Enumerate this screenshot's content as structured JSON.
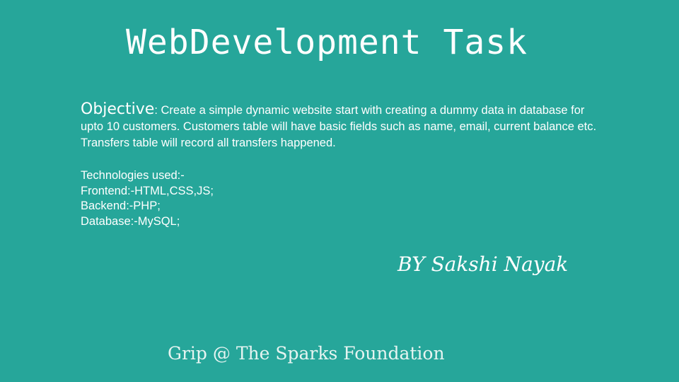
{
  "slide": {
    "title": "WebDevelopment Task",
    "objective": {
      "label": "Objective",
      "separator": ":",
      "text": " Create a simple dynamic website start with creating a dummy data in database for upto 10  customers. Customers table will have basic fields such as name, email,  current balance etc. Transfers table will record all transfers  happened."
    },
    "technologies": {
      "heading": "Technologies used:-",
      "frontend": "Frontend:-HTML,CSS,JS;",
      "backend": "Backend:-PHP;",
      "database": "Database:-MySQL;"
    },
    "author": "BY Sakshi Nayak",
    "footer": "Grip @ The Sparks Foundation"
  },
  "colors": {
    "background": "#26a69a",
    "text": "#ffffff"
  }
}
